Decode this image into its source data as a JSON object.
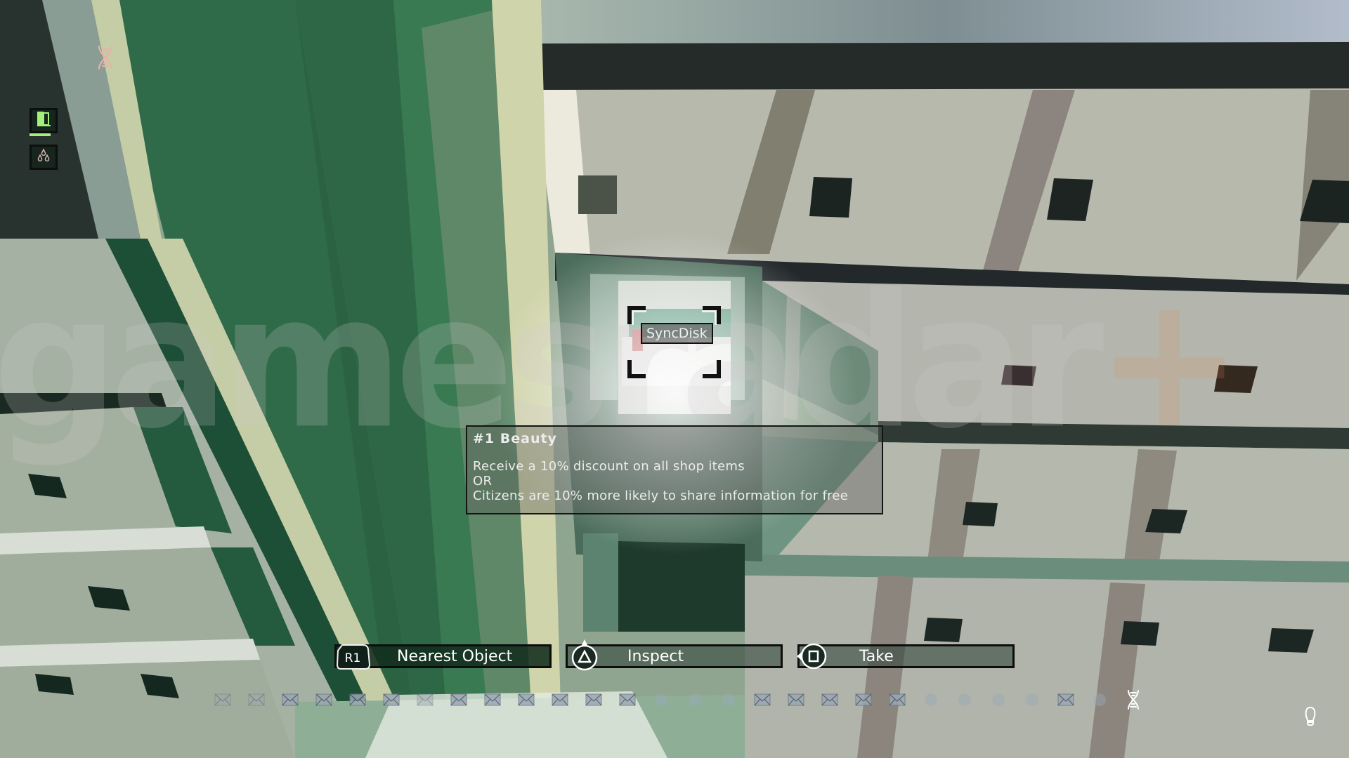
{
  "game": {
    "target_object": {
      "label": "SyncDisk"
    },
    "tooltip": {
      "title": "#1 Beauty",
      "lines": [
        "Receive a 10% discount on all shop items",
        "OR",
        "Citizens are 10% more likely to share information for free"
      ]
    },
    "actions": [
      {
        "key": "R1",
        "key_icon": "r1-button-icon",
        "label": "Nearest Object"
      },
      {
        "key": "triangle",
        "key_icon": "triangle-button-icon",
        "label": "Inspect"
      },
      {
        "key": "square",
        "key_icon": "square-button-icon",
        "label": "Take"
      }
    ],
    "left_hud": {
      "top_icon": "dna-icon",
      "buttons": [
        {
          "icon": "case-board-icon",
          "active": true
        },
        {
          "icon": "fingerprint-drops-icon",
          "active": false
        }
      ]
    },
    "status_strip": {
      "items": [
        "envelope-faded",
        "envelope-faded",
        "envelope",
        "envelope",
        "envelope",
        "envelope",
        "envelope-faded",
        "envelope",
        "envelope",
        "envelope",
        "envelope",
        "envelope",
        "envelope",
        "circle",
        "circle",
        "circle",
        "envelope",
        "envelope",
        "envelope",
        "envelope",
        "envelope",
        "circle",
        "circle",
        "circle",
        "circle",
        "envelope",
        "circle"
      ]
    },
    "bottom_right_icons": [
      "dna-icon",
      "footprint-icon"
    ],
    "watermark": {
      "text": "gamesradar",
      "suffix": "+"
    },
    "colors": {
      "accent_green": "#a6f07a",
      "dna_pink": "#e8b2a8",
      "hud_text": "#ffffff"
    }
  }
}
